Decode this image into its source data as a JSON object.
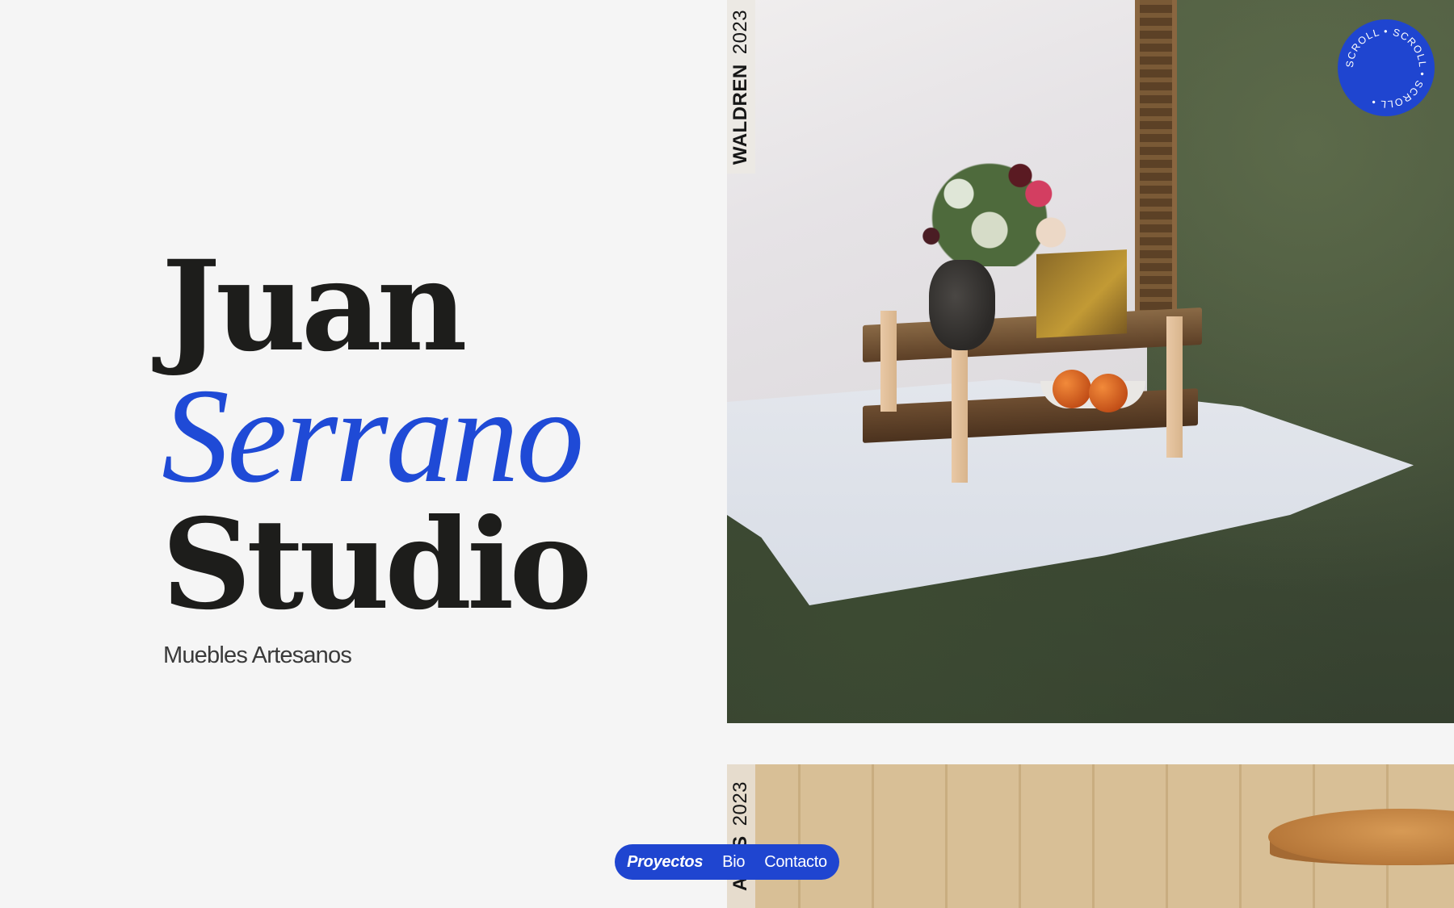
{
  "hero": {
    "title_line1": "Juan",
    "title_line2": "Serrano",
    "title_line3": "Studio",
    "subtitle": "Muebles Artesanos"
  },
  "projects": [
    {
      "name": "WALDREN",
      "year": "2023",
      "image": "outdoor-shelf-photo"
    },
    {
      "name": "ALOS",
      "year": "2023",
      "image": "interior-table-photo"
    }
  ],
  "scroll_badge": {
    "text": "SCROLL • SCROLL • SCROLL •"
  },
  "nav": {
    "items": [
      {
        "label": "Proyectos",
        "active": true
      },
      {
        "label": "Bio",
        "active": false
      },
      {
        "label": "Contacto",
        "active": false
      }
    ]
  },
  "colors": {
    "accent": "#1f45d0",
    "text": "#1d1d1b",
    "background": "#f5f5f5"
  }
}
